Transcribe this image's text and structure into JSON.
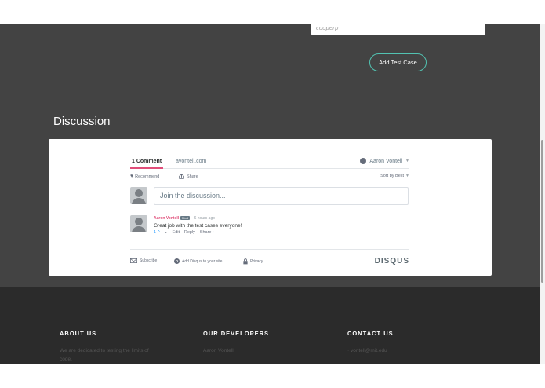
{
  "form": {
    "author_value": "cooperp",
    "add_test_label": "Add Test Case"
  },
  "discussion": {
    "title": "Discussion",
    "tab_comments": "1 Comment",
    "tab_site": "avontell.com",
    "user_name": "Aaron Vontell",
    "recommend_label": "Recommend",
    "share_label": "Share",
    "sort_label": "Sort by Best",
    "join_placeholder": "Join the discussion...",
    "comment": {
      "author": "Aaron Vontell",
      "badge": "Mod",
      "time": "6 hours ago",
      "text": "Great job with the test cases everyone!",
      "votes": "1",
      "edit": "Edit",
      "reply": "Reply",
      "share": "Share ›"
    },
    "subscribe_label": "Subscribe",
    "add_disqus_label": "Add Disqus to your site",
    "privacy_label": "Privacy",
    "brand": "DISQUS"
  },
  "footer": {
    "about_title": "ABOUT US",
    "about_text": "We are dedicated to testing the limits of code.",
    "dev_title": "OUR DEVELOPERS",
    "dev_text": "Aaron Vontell",
    "contact_title": "CONTACT US",
    "contact_text": "· vontell@mit.edu"
  },
  "colors": {
    "accent_teal": "#52c2b1",
    "disqus_pink": "#e14e7a",
    "main_bg": "#434343",
    "footer_bg": "#2b2b2b"
  }
}
